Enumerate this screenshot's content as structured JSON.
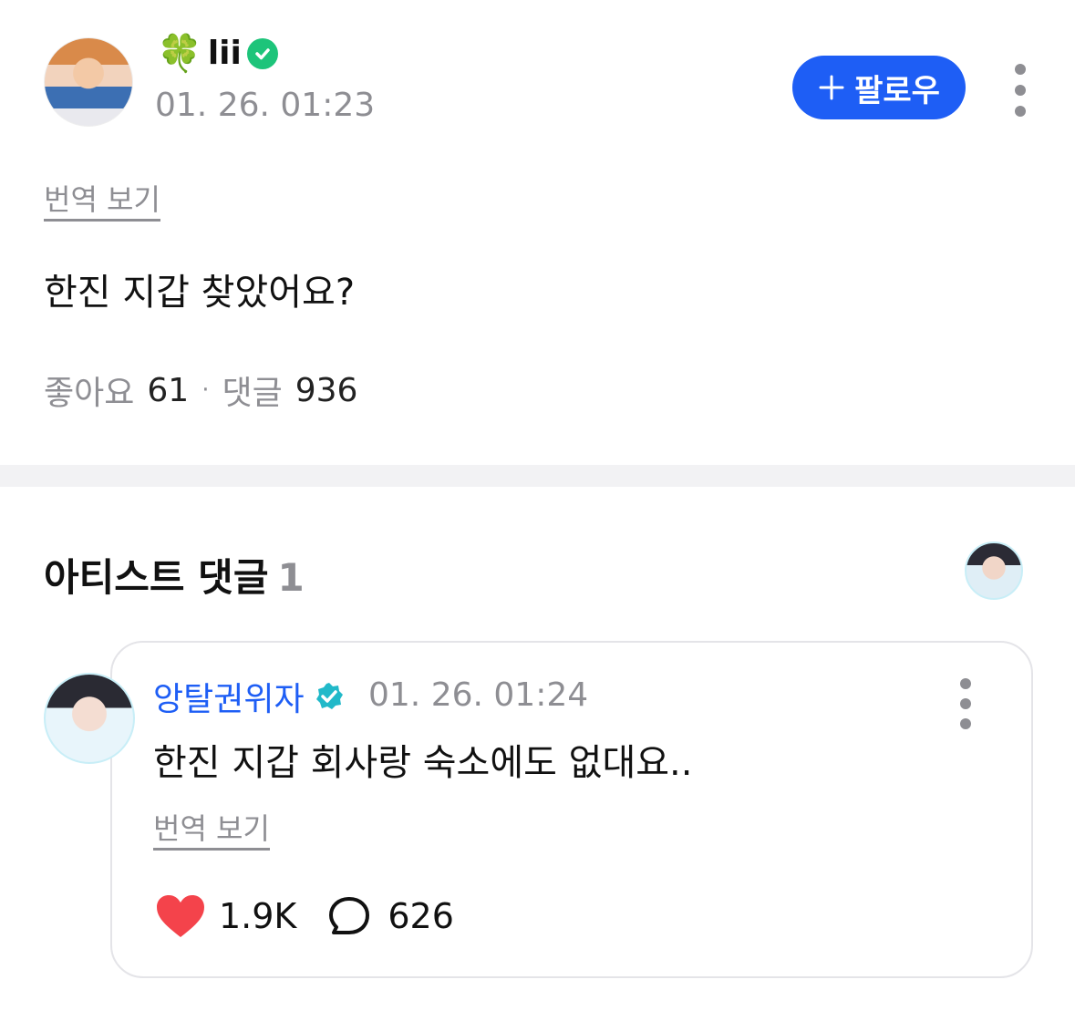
{
  "post": {
    "username": "lii",
    "username_prefix_icon": "four-leaf-clover",
    "timestamp": "01. 26. 01:23",
    "follow_label": "팔로우",
    "translate_label": "번역 보기",
    "body": "한진 지갑 찾았어요?",
    "likes_label": "좋아요",
    "likes_count": "61",
    "separator": "·",
    "comments_label": "댓글",
    "comments_count": "936"
  },
  "artist_section": {
    "title": "아티스트 댓글",
    "count": "1"
  },
  "comment": {
    "author": "앙탈권위자",
    "timestamp": "01. 26. 01:24",
    "body": "한진 지갑 회사랑 숙소에도 없대요..",
    "translate_label": "번역 보기",
    "likes": "1.9K",
    "replies": "626"
  },
  "colors": {
    "accent_blue": "#1e5ef5",
    "verified_green": "#1dc47a",
    "verified_teal": "#21b9c9",
    "heart_red": "#f4434b",
    "muted_gray": "#8e8e93"
  }
}
